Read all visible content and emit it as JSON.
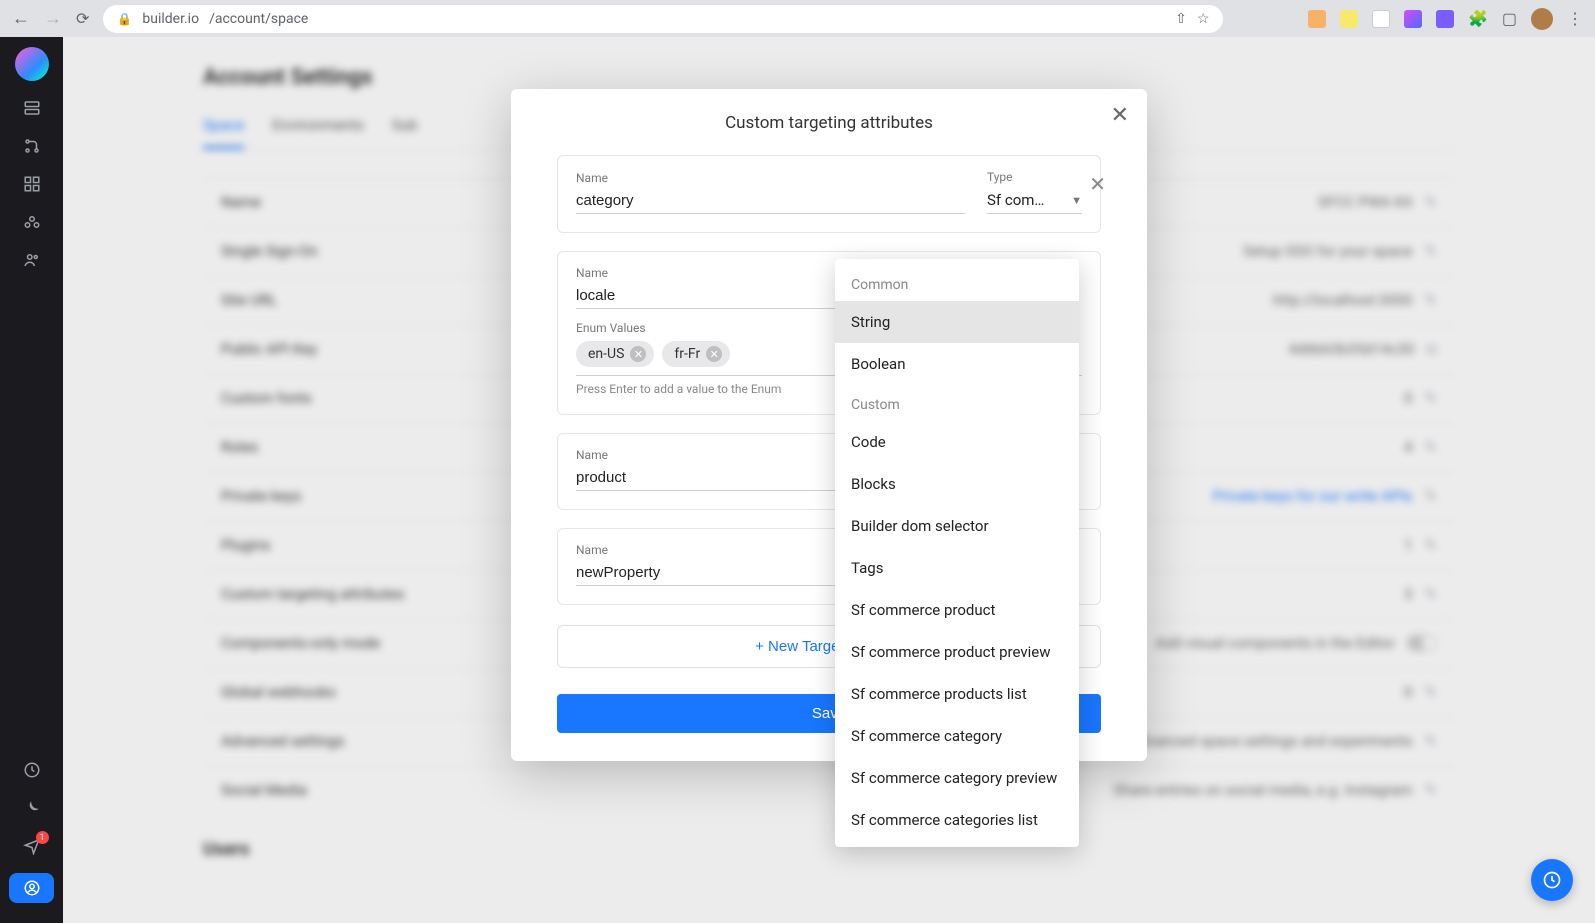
{
  "browser": {
    "url_host": "builder.io",
    "url_path": "/account/space"
  },
  "page": {
    "title": "Account Settings",
    "tab_space": "Space",
    "tab_environments": "Environments",
    "tab_sub": "Sub",
    "users_heading": "Users"
  },
  "settings_rows": [
    {
      "label": "Name",
      "value": "SFCC PWA Kit"
    },
    {
      "label": "Single Sign-On",
      "value": "Setup SSO for your space"
    },
    {
      "label": "Site URL",
      "value": "http://localhost:3000"
    },
    {
      "label": "Public API Key",
      "value": "4d6b63b35d14c30"
    },
    {
      "label": "Custom fonts",
      "value": "0"
    },
    {
      "label": "Roles",
      "value": "4"
    },
    {
      "label": "Private keys",
      "value": "Private keys for our write APIs"
    },
    {
      "label": "Plugins",
      "value": "1"
    },
    {
      "label": "Custom targeting attributes",
      "value": "3"
    },
    {
      "label": "Components-only mode",
      "value": "Add visual components in the Editor"
    },
    {
      "label": "Global webhooks",
      "value": "0"
    },
    {
      "label": "Advanced settings",
      "value": "Advanced space settings and experiments"
    },
    {
      "label": "Social Media",
      "value": "Share entries on social media, e.g. Instagram"
    }
  ],
  "modal": {
    "title": "Custom targeting attributes",
    "name_label": "Name",
    "type_label": "Type",
    "enum_label": "Enum Values",
    "enum_hint": "Press Enter to add a value to the Enum",
    "add_attr": "+ New Target Attribute",
    "save": "Save",
    "attrs": [
      {
        "name": "category",
        "type_display": "Sf com…"
      },
      {
        "name": "locale",
        "type_display": "",
        "enum": [
          "en-US",
          "fr-Fr"
        ]
      },
      {
        "name": "product",
        "type_display": ""
      },
      {
        "name": "newProperty",
        "type_display": ""
      }
    ]
  },
  "dropdown": {
    "group_common": "Common",
    "group_custom": "Custom",
    "items_common": [
      "String",
      "Boolean"
    ],
    "items_custom": [
      "Code",
      "Blocks",
      "Builder dom selector",
      "Tags",
      "Sf commerce product",
      "Sf commerce product preview",
      "Sf commerce products list",
      "Sf commerce category",
      "Sf commerce category preview",
      "Sf commerce categories list"
    ],
    "selected": "String"
  }
}
